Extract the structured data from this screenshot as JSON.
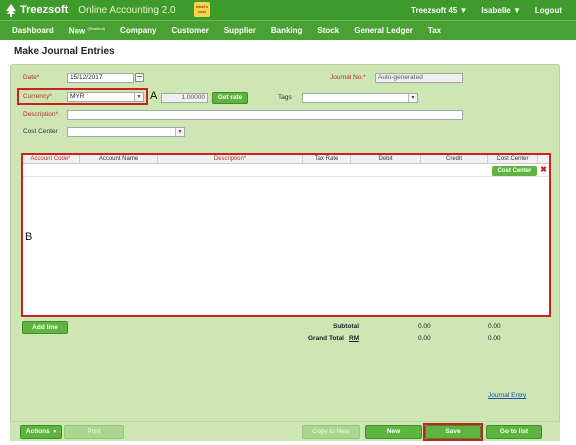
{
  "header": {
    "brand": "Treezsoft",
    "tagline": "Online Accounting 2.0",
    "whats_new": "what's new",
    "company": "Treezsoft 45 ▼",
    "user": "Isabelle ▼",
    "logout": "Logout"
  },
  "nav": [
    {
      "label": "Dashboard"
    },
    {
      "label": "New",
      "sup": "(Shortcut)"
    },
    {
      "label": "Company"
    },
    {
      "label": "Customer"
    },
    {
      "label": "Supplier"
    },
    {
      "label": "Banking"
    },
    {
      "label": "Stock"
    },
    {
      "label": "General Ledger"
    },
    {
      "label": "Tax"
    }
  ],
  "page_title": "Make Journal Entries",
  "form": {
    "date_label": "Date*",
    "date_value": "15/12/2017",
    "currency_label": "Currency*",
    "currency_value": "MYR",
    "rate_value": "1.00000",
    "get_rate": "Get rate",
    "tags_label": "Tags",
    "journal_no_label": "Journal No.*",
    "journal_no_value": "Auto-generated",
    "description_label": "Description*",
    "cost_center_label": "Cost Center"
  },
  "annotations": {
    "a": "A",
    "b": "B"
  },
  "grid": {
    "columns": [
      "Account Code*",
      "Account Name",
      "Description*",
      "Tax Rate",
      "Debit",
      "Credit",
      "Cost Center"
    ],
    "cost_center_button": "Cost Center",
    "delete": "✖"
  },
  "actions": {
    "add_line": "Add line"
  },
  "totals": {
    "subtotal_label": "Subtotal",
    "grand_total_label": "Grand Total",
    "currency": "RM",
    "subtotal_debit": "0.00",
    "subtotal_credit": "0.00",
    "grand_debit": "0.00",
    "grand_credit": "0.00"
  },
  "journal_entry_link": "Journal Entry",
  "footer": {
    "actions": "Actions",
    "print": "Print",
    "copy_to_new": "Copy to New",
    "new": "New",
    "save": "Save",
    "go_to_list": "Go to list"
  },
  "colors": {
    "header_green": "#3f9a2c",
    "panel_green": "#cde6b4",
    "button_green": "#5db43f",
    "highlight_red": "#cc1f1f"
  }
}
